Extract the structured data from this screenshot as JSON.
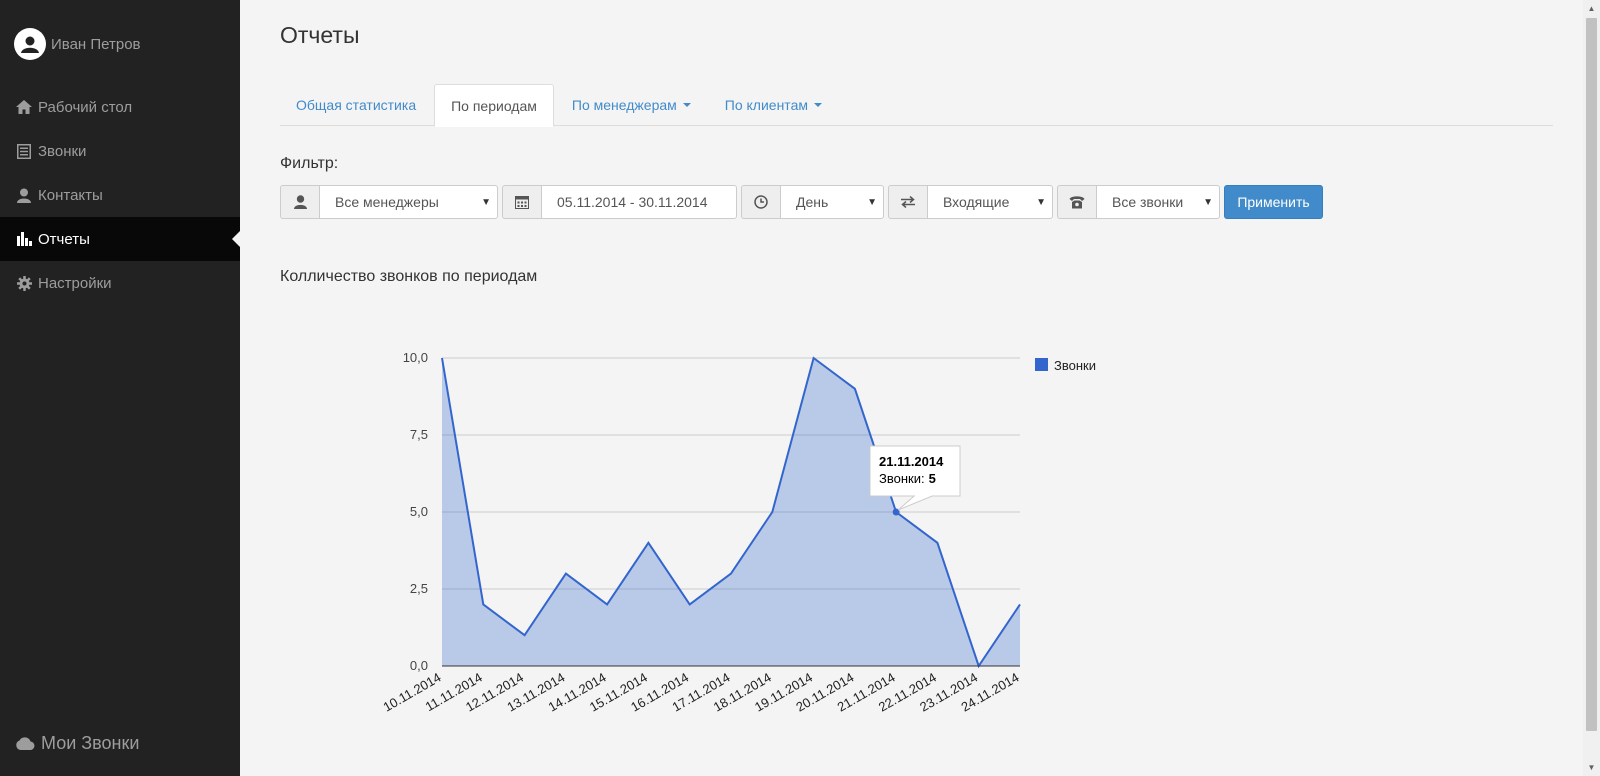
{
  "user": {
    "name": "Иван Петров",
    "icon": "user-icon"
  },
  "nav": [
    {
      "label": "Рабочий стол",
      "icon": "home-icon",
      "active": false
    },
    {
      "label": "Звонки",
      "icon": "list-icon",
      "active": false
    },
    {
      "label": "Контакты",
      "icon": "user-icon",
      "active": false
    },
    {
      "label": "Отчеты",
      "icon": "bar-chart-icon",
      "active": true
    },
    {
      "label": "Настройки",
      "icon": "gear-icon",
      "active": false
    }
  ],
  "brand": {
    "label": "Мои Звонки",
    "icon": "cloud-icon"
  },
  "page": {
    "title": "Отчеты"
  },
  "tabs": [
    {
      "label": "Общая статистика"
    },
    {
      "label": "По периодам"
    },
    {
      "label": "По менеджерам"
    },
    {
      "label": "По клиентам"
    }
  ],
  "filter": {
    "label": "Фильтр:",
    "manager": "Все менеджеры",
    "date_range": "05.11.2014 - 30.11.2014",
    "period": "День",
    "direction": "Входящие",
    "calls": "Все звонки",
    "apply_label": "Применить"
  },
  "chart_title": "Колличество звонков по периодам",
  "chart_data": {
    "type": "area",
    "x": [
      "10.11.2014",
      "11.11.2014",
      "12.11.2014",
      "13.11.2014",
      "14.11.2014",
      "15.11.2014",
      "16.11.2014",
      "17.11.2014",
      "18.11.2014",
      "19.11.2014",
      "20.11.2014",
      "21.11.2014",
      "22.11.2014",
      "23.11.2014",
      "24.11.2014"
    ],
    "series": [
      {
        "name": "Звонки",
        "values": [
          10,
          2,
          1,
          3,
          2,
          4,
          2,
          3,
          5,
          10,
          9,
          5,
          4,
          0,
          2
        ],
        "color": "#3366cc"
      }
    ],
    "ylim": [
      0,
      10
    ],
    "yticks": [
      0,
      2.5,
      5,
      7.5,
      10
    ],
    "ytick_labels": [
      "0,0",
      "2,5",
      "5,0",
      "7,5",
      "10,0"
    ],
    "legend": "right",
    "grid": true
  },
  "tooltip": {
    "date": "21.11.2014",
    "label": "Звонки:",
    "value": "5"
  }
}
